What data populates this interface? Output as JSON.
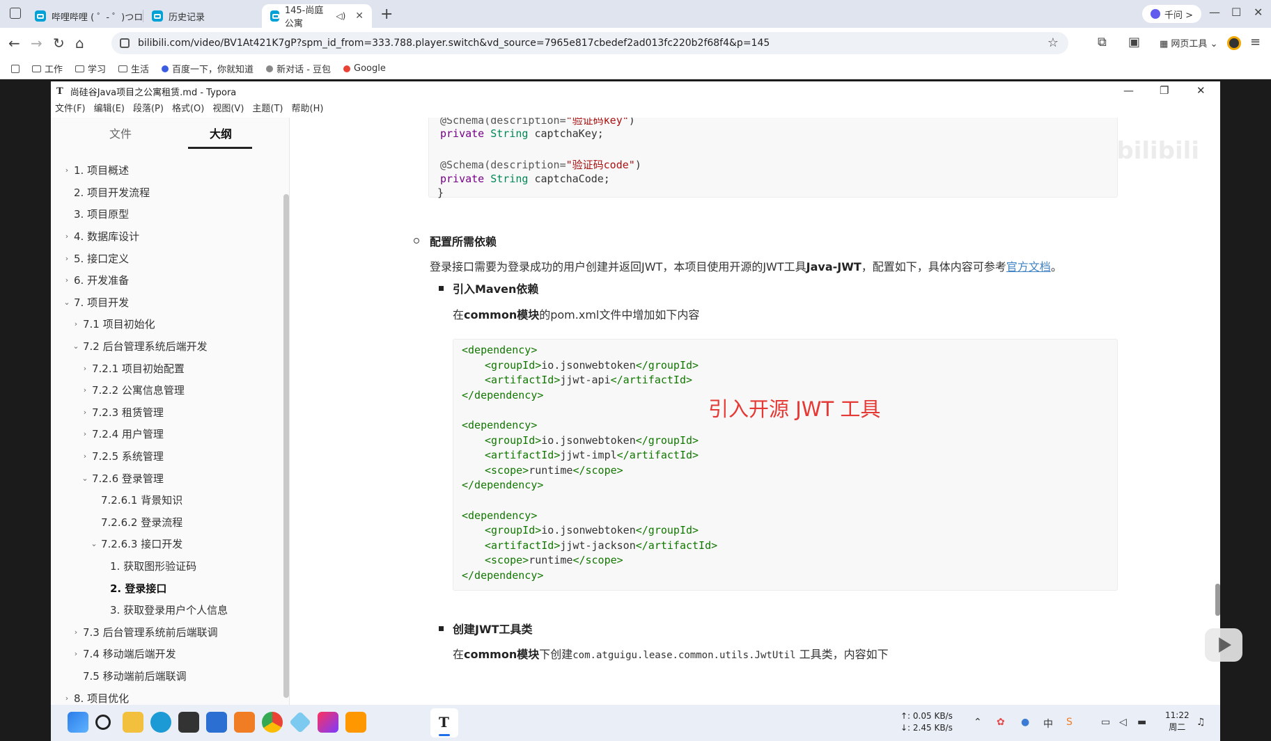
{
  "browser": {
    "tabs": [
      {
        "label": "哔哩哔哩 ( ゜- ゜)つロ",
        "active": false
      },
      {
        "label": "历史记录",
        "active": false
      },
      {
        "label": "145-尚庭公寓",
        "active": true
      }
    ],
    "new_tab": "+",
    "qianwen_label": "千问 >",
    "url": "bilibili.com/video/BV1At421K7gP?spm_id_from=333.788.player.switch&vd_source=7965e817cbedef2ad013fc220b2f68f4&p=145",
    "web_tools_label": "网页工具",
    "bookmarks": [
      {
        "label": "工作",
        "icon": "folder-icon"
      },
      {
        "label": "学习",
        "icon": "folder-icon"
      },
      {
        "label": "生活",
        "icon": "folder-icon"
      },
      {
        "label": "百度一下，你就知道",
        "icon": "baidu-icon"
      },
      {
        "label": "新对话 - 豆包",
        "icon": "doubao-icon"
      },
      {
        "label": "Google",
        "icon": "google-icon"
      }
    ]
  },
  "typora": {
    "title": "尚硅谷Java项目之公寓租赁.md - Typora",
    "menu": [
      "文件(F)",
      "编辑(E)",
      "段落(P)",
      "格式(O)",
      "视图(V)",
      "主题(T)",
      "帮助(H)"
    ],
    "sidebar_tabs": [
      "文件",
      "大纲"
    ],
    "outline": [
      {
        "label": "1. 项目概述",
        "level": 0,
        "arrow": "›"
      },
      {
        "label": "2. 项目开发流程",
        "level": 0,
        "arrow": ""
      },
      {
        "label": "3. 项目原型",
        "level": 0,
        "arrow": ""
      },
      {
        "label": "4. 数据库设计",
        "level": 0,
        "arrow": "›"
      },
      {
        "label": "5. 接口定义",
        "level": 0,
        "arrow": "›"
      },
      {
        "label": "6. 开发准备",
        "level": 0,
        "arrow": "›"
      },
      {
        "label": "7. 项目开发",
        "level": 0,
        "arrow": "⌄"
      },
      {
        "label": "7.1 项目初始化",
        "level": 1,
        "arrow": "›"
      },
      {
        "label": "7.2 后台管理系统后端开发",
        "level": 1,
        "arrow": "⌄"
      },
      {
        "label": "7.2.1 项目初始配置",
        "level": 2,
        "arrow": "›"
      },
      {
        "label": "7.2.2 公寓信息管理",
        "level": 2,
        "arrow": "›"
      },
      {
        "label": "7.2.3 租赁管理",
        "level": 2,
        "arrow": "›"
      },
      {
        "label": "7.2.4 用户管理",
        "level": 2,
        "arrow": "›"
      },
      {
        "label": "7.2.5 系统管理",
        "level": 2,
        "arrow": "›"
      },
      {
        "label": "7.2.6 登录管理",
        "level": 2,
        "arrow": "⌄"
      },
      {
        "label": "7.2.6.1 背景知识",
        "level": 3,
        "arrow": ""
      },
      {
        "label": "7.2.6.2 登录流程",
        "level": 3,
        "arrow": ""
      },
      {
        "label": "7.2.6.3 接口开发",
        "level": 3,
        "arrow": "⌄"
      },
      {
        "label": "1. 获取图形验证码",
        "level": 4,
        "arrow": ""
      },
      {
        "label": "2. 登录接口",
        "level": 4,
        "arrow": "",
        "active": true
      },
      {
        "label": "3. 获取登录用户个人信息",
        "level": 4,
        "arrow": ""
      },
      {
        "label": "7.3 后台管理系统前后端联调",
        "level": 1,
        "arrow": "›"
      },
      {
        "label": "7.4 移动端后端开发",
        "level": 1,
        "arrow": "›"
      },
      {
        "label": "7.5 移动端前后端联调",
        "level": 1,
        "arrow": ""
      },
      {
        "label": "8. 项目优化",
        "level": 0,
        "arrow": "›"
      }
    ],
    "doc": {
      "top_code": {
        "line1_annot": "@Schema(description=",
        "line1_str": "\"验证码key\"",
        "line1_end": ")",
        "line2_kw": "private",
        "line2_type": "String",
        "line2_var": "captchaKey;",
        "line3_annot": "@Schema(description=",
        "line3_str": "\"验证码code\"",
        "line3_end": ")",
        "line4_kw": "private",
        "line4_type": "String",
        "line4_var": "captchaCode;",
        "line5": "}"
      },
      "h_config": "配置所需依赖",
      "p_intro_1": "登录接口需要为登录成功的用户创建并返回JWT，本项目使用开源的JWT工具",
      "p_intro_bold": "Java-JWT",
      "p_intro_2": "，配置如下，具体内容可参考",
      "p_intro_link": "官方文档",
      "p_intro_end": "。",
      "h_maven": "引入Maven依赖",
      "p_common_1": "在",
      "p_common_bold": "common模块",
      "p_common_2": "的pom.xml文件中增加如下内容",
      "xml_lines": [
        {
          "indent": 0,
          "open": "<dependency>",
          "value": "",
          "close": ""
        },
        {
          "indent": 1,
          "open": "<groupId>",
          "value": "io.jsonwebtoken",
          "close": "</groupId>"
        },
        {
          "indent": 1,
          "open": "<artifactId>",
          "value": "jjwt-api",
          "close": "</artifactId>"
        },
        {
          "indent": 0,
          "open": "</dependency>",
          "value": "",
          "close": ""
        },
        {
          "indent": 0,
          "open": "",
          "value": "",
          "close": ""
        },
        {
          "indent": 0,
          "open": "<dependency>",
          "value": "",
          "close": ""
        },
        {
          "indent": 1,
          "open": "<groupId>",
          "value": "io.jsonwebtoken",
          "close": "</groupId>"
        },
        {
          "indent": 1,
          "open": "<artifactId>",
          "value": "jjwt-impl",
          "close": "</artifactId>"
        },
        {
          "indent": 1,
          "open": "<scope>",
          "value": "runtime",
          "close": "</scope>"
        },
        {
          "indent": 0,
          "open": "</dependency>",
          "value": "",
          "close": ""
        },
        {
          "indent": 0,
          "open": "",
          "value": "",
          "close": ""
        },
        {
          "indent": 0,
          "open": "<dependency>",
          "value": "",
          "close": ""
        },
        {
          "indent": 1,
          "open": "<groupId>",
          "value": "io.jsonwebtoken",
          "close": "</groupId>"
        },
        {
          "indent": 1,
          "open": "<artifactId>",
          "value": "jjwt-jackson",
          "close": "</artifactId>"
        },
        {
          "indent": 1,
          "open": "<scope>",
          "value": "runtime",
          "close": "</scope>"
        },
        {
          "indent": 0,
          "open": "</dependency>",
          "value": "",
          "close": ""
        }
      ],
      "annotation": "引入开源 JWT 工具",
      "h_jwtutil": "创建JWT工具类",
      "p_util_1": "在",
      "p_util_bold": "common模块",
      "p_util_2": "下创建",
      "p_util_code": "com.atguigu.lease.common.utils.JwtUtil",
      "p_util_3": "工具类，内容如下",
      "watermark": "尚硅谷 bilibili"
    }
  },
  "taskbar": {
    "net_up": "↑: 0.05 KB/s",
    "net_down": "↓: 2.45 KB/s",
    "time": "11:22",
    "day": "周二"
  },
  "colors": {
    "accent": "#4183c4",
    "annotation": "#e53935",
    "bilibili": "#00a1d6"
  }
}
